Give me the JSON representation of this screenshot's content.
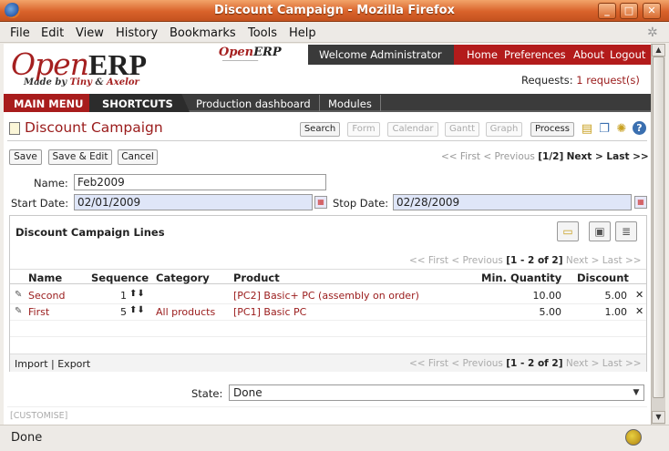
{
  "window": {
    "title": "Discount Campaign - Mozilla Firefox"
  },
  "menubar": [
    "File",
    "Edit",
    "View",
    "History",
    "Bookmarks",
    "Tools",
    "Help"
  ],
  "header": {
    "logo_open": "Open",
    "logo_erp": "ERP",
    "logo_made_by": "Made by",
    "logo_tiny": "Tiny",
    "logo_amp": "&",
    "logo_axelor": "Axelor",
    "logo2_open": "Open",
    "logo2_erp": "ERP",
    "welcome": "Welcome Administrator",
    "links": [
      "Home",
      "Preferences",
      "About",
      "Logout"
    ],
    "requests_label": "Requests:",
    "requests_link": "1 request(s)"
  },
  "nav": {
    "main_menu": "MAIN MENU",
    "shortcuts": "SHORTCUTS",
    "items": [
      "Production dashboard",
      "Modules"
    ]
  },
  "page": {
    "title": "Discount Campaign",
    "view_buttons": [
      "Search",
      "Form",
      "Calendar",
      "Gantt",
      "Graph",
      "Process"
    ],
    "actions": [
      "Save",
      "Save & Edit",
      "Cancel"
    ],
    "pager": {
      "prev": "<< First < Previous",
      "pos": "[1/2]",
      "next": "Next > Last >>"
    }
  },
  "form": {
    "name_label": "Name:",
    "name_value": "Feb2009",
    "start_label": "Start Date:",
    "start_value": "02/01/2009",
    "stop_label": "Stop Date:",
    "stop_value": "02/28/2009",
    "state_label": "State:",
    "state_value": "Done"
  },
  "lines": {
    "title": "Discount Campaign Lines",
    "pager": {
      "prev": "<< First < Previous",
      "pos": "[1 - 2 of 2]",
      "next": "Next > Last >>"
    },
    "columns": [
      "Name",
      "Sequence",
      "Category",
      "Product",
      "Min. Quantity",
      "Discount"
    ],
    "rows": [
      {
        "name": "Second",
        "sequence": "1",
        "category": "",
        "product": "[PC2] Basic+ PC (assembly on order)",
        "min_qty": "10.00",
        "discount": "5.00"
      },
      {
        "name": "First",
        "sequence": "5",
        "category": "All products",
        "product": "[PC1] Basic PC",
        "min_qty": "5.00",
        "discount": "1.00"
      }
    ],
    "import": "Import",
    "sep": "|",
    "export": "Export"
  },
  "customise": "[CUSTOMISE]",
  "statusbar": {
    "text": "Done"
  },
  "colors": {
    "brand_red": "#9a1b1b",
    "title_orange": "#d9622a"
  }
}
